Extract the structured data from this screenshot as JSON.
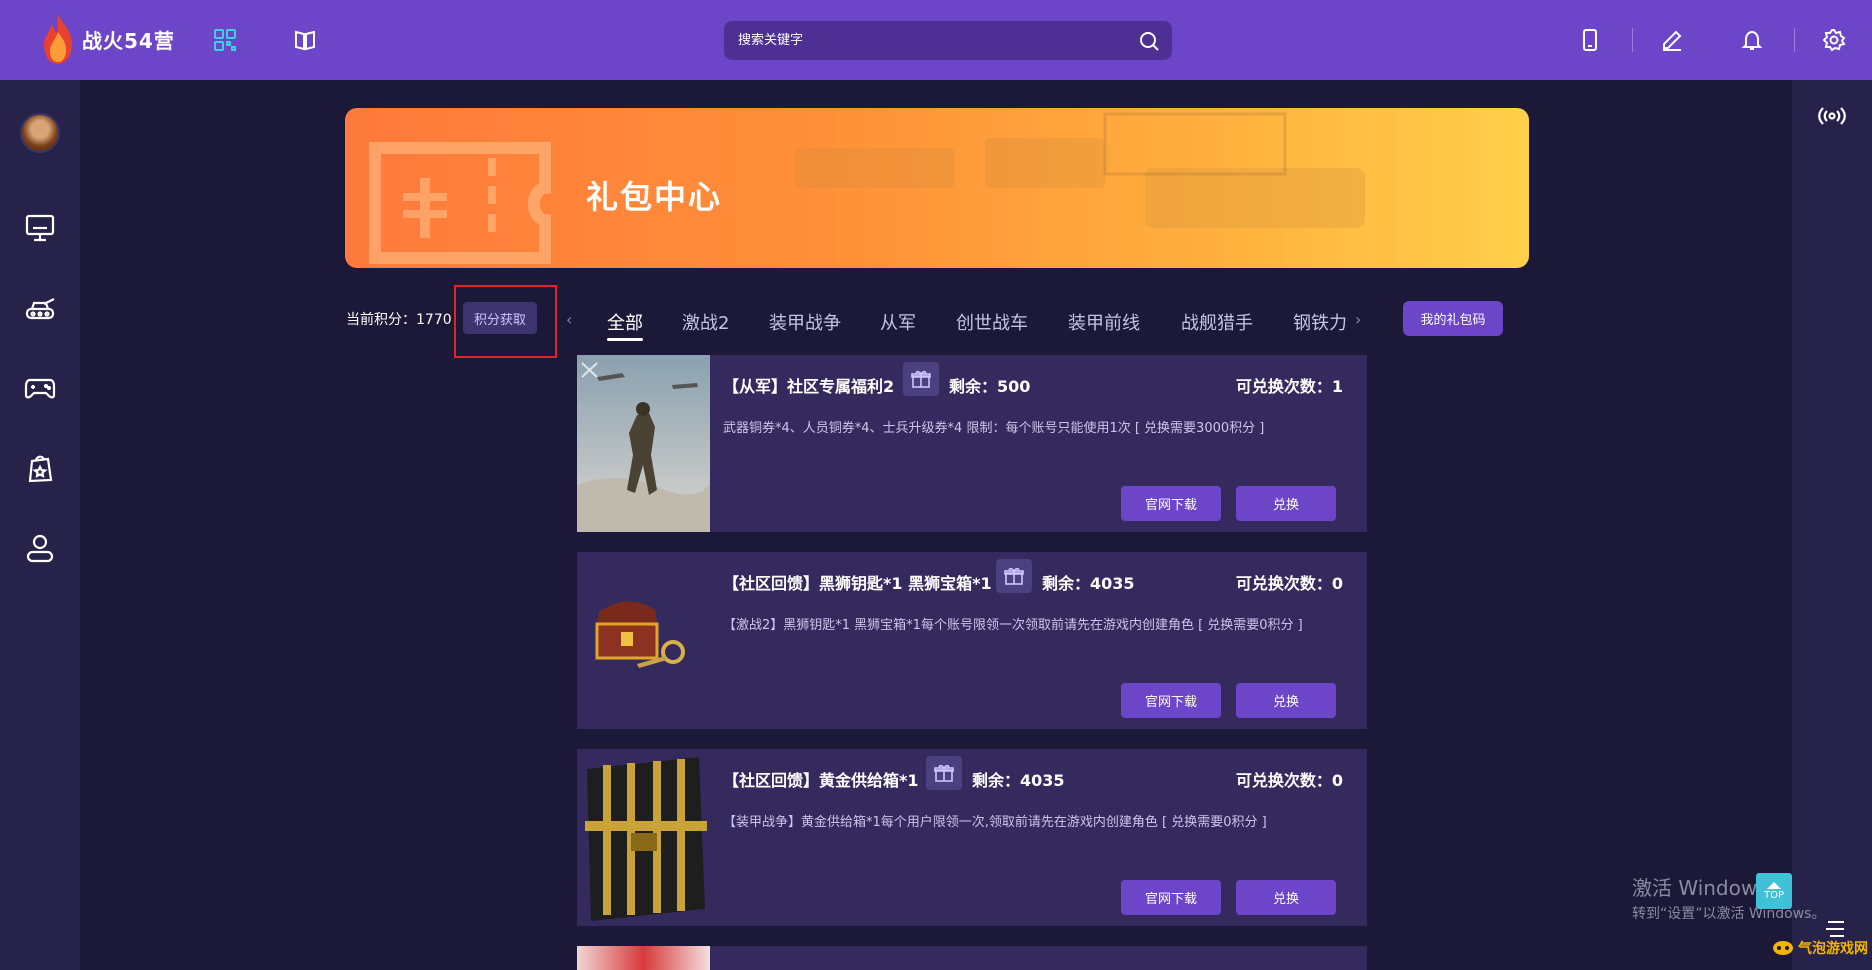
{
  "app": {
    "logo_text": "战火54营"
  },
  "search": {
    "placeholder": "搜索关键字"
  },
  "banner": {
    "title": "礼包中心"
  },
  "points": {
    "label": "当前积分：1770",
    "earn_button": "积分获取"
  },
  "tabs": [
    "全部",
    "激战2",
    "装甲战争",
    "从军",
    "创世战车",
    "装甲前线",
    "战舰猎手",
    "钢铁力"
  ],
  "active_tab": "全部",
  "my_code_button": "我的礼包码",
  "cards": [
    {
      "title": "【从军】社区专属福利2",
      "remain": "剩余：500",
      "times": "可兑换次数：1",
      "desc": "武器铜券*4、人员铜券*4、士兵升级券*4 限制：每个账号只能使用1次 [ 兑换需要3000积分 ]",
      "official": "官网下载",
      "redeem": "兑换"
    },
    {
      "title": "【社区回馈】黑狮钥匙*1 黑狮宝箱*1",
      "remain": "剩余：4035",
      "times": "可兑换次数：0",
      "desc": "【激战2】黑狮钥匙*1 黑狮宝箱*1每个账号限领一次领取前请先在游戏内创建角色 [ 兑换需要0积分 ]",
      "official": "官网下载",
      "redeem": "兑换"
    },
    {
      "title": "【社区回馈】黄金供给箱*1",
      "remain": "剩余：4035",
      "times": "可兑换次数：0",
      "desc": "【装甲战争】黄金供给箱*1每个用户限领一次,领取前请先在游戏内创建角色 [ 兑换需要0积分 ]",
      "official": "官网下载",
      "redeem": "兑换"
    }
  ],
  "watermark": {
    "line1": "激活 Window",
    "line2": "转到“设置”以激活 Windows。"
  },
  "top_button": "TOP",
  "site_logo": "气泡游戏网",
  "colors": {
    "topbar": "#6d45c8",
    "background": "#1b1838",
    "card": "#342a5e",
    "button": "#6d45c8",
    "highlight": "#e0252a"
  },
  "icons": [
    "flame-logo-icon",
    "qr-code-icon",
    "book-icon",
    "search-icon",
    "mobile-icon",
    "edit-icon",
    "bell-icon",
    "gear-icon",
    "desktop-icon",
    "tank-icon",
    "gamepad-icon",
    "gift-bag-icon",
    "user-icon",
    "broadcast-icon",
    "gift-icon"
  ]
}
